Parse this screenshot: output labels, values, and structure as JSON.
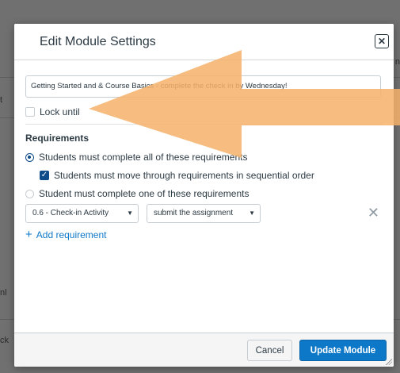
{
  "dialog": {
    "title": "Edit Module Settings",
    "close_symbol": "✕"
  },
  "module": {
    "name_value": "Getting Started and & Course Basics - complete the check in by Wednesday!",
    "lock_label": "Lock until",
    "lock_checked": false
  },
  "requirements": {
    "heading": "Requirements",
    "options": [
      {
        "label": "Students must complete all of these requirements",
        "selected": true
      },
      {
        "label": "Students must move through requirements in sequential order",
        "checked": true
      },
      {
        "label": "Student must complete one of these requirements",
        "selected": false
      }
    ],
    "item_select": "0.6 - Check-in Activity",
    "action_select": "submit the assignment",
    "caret_symbol": "▼",
    "remove_symbol": "✕",
    "add_plus": "+",
    "add_label": "Add requirement"
  },
  "footer": {
    "cancel_label": "Cancel",
    "update_label": "Update Module"
  },
  "background_fragments": {
    "left_a": "t",
    "left_b": "nl",
    "left_c": "ck",
    "right_a": "n"
  },
  "colors": {
    "primary": "#0e78c8",
    "overlay": "#707070",
    "arrow": "#f6b16a"
  },
  "icons": {
    "close": "close-icon",
    "remove": "close-icon",
    "add": "plus-icon",
    "checkbox": "checkmark-icon"
  }
}
